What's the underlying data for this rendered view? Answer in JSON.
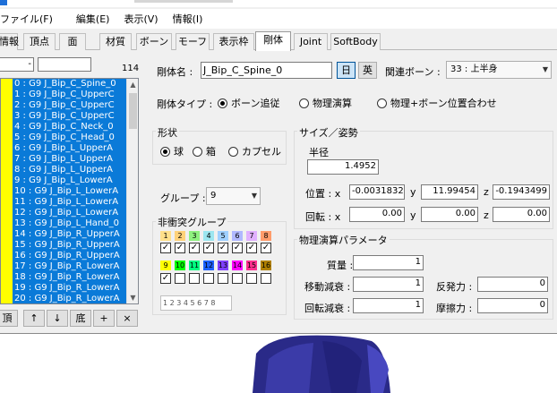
{
  "menubar": {
    "items": [
      "ファイル(F)",
      "編集(E)",
      "表示(V)",
      "情報(I)"
    ]
  },
  "tabs": [
    "情報",
    "頂点",
    "面",
    "材質",
    "ボーン",
    "モーフ",
    "表示枠",
    "剛体",
    "Joint",
    "SoftBody"
  ],
  "active_tab": "剛体",
  "left": {
    "filter_value": "-",
    "search_value": "",
    "count": "114",
    "bones": [
      "0 : G9  J_Bip_C_Spine_0",
      "1 : G9  J_Bip_C_UpperC",
      "2 : G9  J_Bip_C_UpperC",
      "3 : G9  J_Bip_C_UpperC",
      "4 : G9  J_Bip_C_Neck_0",
      "5 : G9  J_Bip_C_Head_0",
      "6 : G9  J_Bip_L_UpperA",
      "7 : G9  J_Bip_L_UpperA",
      "8 : G9  J_Bip_L_UpperA",
      "9 : G9  J_Bip_L_LowerA",
      "10 : G9  J_Bip_L_LowerA",
      "11 : G9  J_Bip_L_LowerA",
      "12 : G9  J_Bip_L_LowerA",
      "13 : G9  J_Bip_L_Hand_0",
      "14 : G9  J_Bip_R_UpperA",
      "15 : G9  J_Bip_R_UpperA",
      "16 : G9  J_Bip_R_UpperA",
      "17 : G9  J_Bip_R_LowerA",
      "18 : G9  J_Bip_R_LowerA",
      "19 : G9  J_Bip_R_LowerA",
      "20 : G9  J_Bip_R_LowerA"
    ],
    "nav": {
      "top": "頂",
      "up": "↑",
      "down": "↓",
      "bottom": "底",
      "add": "+",
      "delete": "×"
    }
  },
  "body": {
    "name_label": "剛体名 :",
    "name_value": "J_Bip_C_Spine_0",
    "lang_jp": "日",
    "lang_en": "英",
    "related_bone_label": "関連ボーン :",
    "related_bone_value": "33 : 上半身",
    "type_label": "剛体タイプ :",
    "type_options": [
      "ボーン追従",
      "物理演算",
      "物理+ボーン位置合わせ"
    ],
    "shape_title": "形状",
    "shape_options": [
      "球",
      "箱",
      "カプセル"
    ],
    "size_title": "サイズ／姿勢",
    "radius_label": "半径",
    "radius_value": "1.4952",
    "pos_label": "位置 : x",
    "pos_x": "-0.0031832",
    "pos_y": "11.99454",
    "pos_z": "-0.1943499",
    "rot_label": "回転 : x",
    "rot_x": "0.00",
    "rot_y": "0.00",
    "rot_z": "0.00",
    "y_label": "y",
    "z_label": "z",
    "group_label": "グループ :",
    "group_value": "9",
    "nocollide_title": "非衝突グループ",
    "nocollide_strip": "1 2 3 4 5 6 7 8",
    "physics_title": "物理演算パラメータ",
    "mass_label": "質量 :",
    "mass_value": "1",
    "lin_damp_label": "移動減衰 :",
    "lin_damp_value": "1",
    "ang_damp_label": "回転減衰 :",
    "ang_damp_value": "1",
    "restitution_label": "反発力 :",
    "restitution_value": "0",
    "friction_label": "摩擦力 :",
    "friction_value": "0"
  },
  "groups": {
    "row1_numbers": [
      "1",
      "2",
      "3",
      "4",
      "5",
      "6",
      "7",
      "8"
    ],
    "row1_colors": [
      "#ffe08a",
      "#ffd27a",
      "#8ef07e",
      "#9ce6f0",
      "#9fd0ff",
      "#b0b8ff",
      "#e0b0ff",
      "#ff9c6b"
    ],
    "row1_checked": [
      true,
      true,
      true,
      true,
      true,
      true,
      true,
      true
    ],
    "row2_numbers": [
      "9",
      "10",
      "11",
      "12",
      "13",
      "14",
      "15",
      "16"
    ],
    "row2_colors": [
      "#ffff00",
      "#00ff00",
      "#00ff7f",
      "#1e60ff",
      "#8040ff",
      "#ff00ff",
      "#ff2f8f",
      "#b08000"
    ],
    "row2_checked": [
      true,
      false,
      false,
      false,
      false,
      false,
      false,
      false
    ]
  },
  "colors": {
    "selection": "#0a7ad8",
    "index_marker": "#ffff00"
  }
}
